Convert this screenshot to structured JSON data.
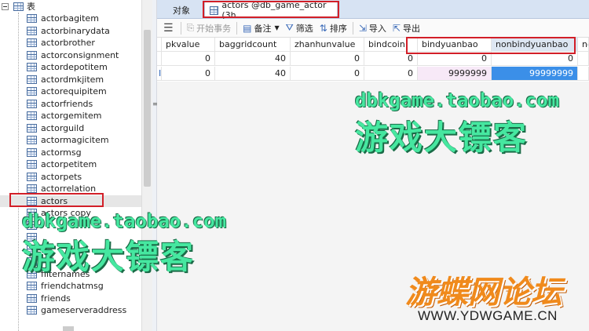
{
  "tree": {
    "root_label": "表",
    "items": [
      {
        "label": "actorbagitem"
      },
      {
        "label": "actorbinarydata"
      },
      {
        "label": "actorbrother"
      },
      {
        "label": "actorconsignment"
      },
      {
        "label": "actordepotitem"
      },
      {
        "label": "actordmkjitem"
      },
      {
        "label": "actorequipitem"
      },
      {
        "label": "actorfriends"
      },
      {
        "label": "actorgemitem"
      },
      {
        "label": "actorguild"
      },
      {
        "label": "actormagicitem"
      },
      {
        "label": "actormsg"
      },
      {
        "label": "actorpetitem"
      },
      {
        "label": "actorpets"
      },
      {
        "label": "actorrelation"
      },
      {
        "label": "actors"
      },
      {
        "label": "actors copy"
      },
      {
        "label": ""
      },
      {
        "label": ""
      },
      {
        "label": ""
      },
      {
        "label": ""
      },
      {
        "label": "filternames"
      },
      {
        "label": "friendchatmsg"
      },
      {
        "label": "friends"
      },
      {
        "label": "gameserveraddress"
      }
    ],
    "selected_index": 15
  },
  "tabs": {
    "objects": "对象",
    "actors": "actors @db_game_actor (3h..."
  },
  "toolbar": {
    "begin_transaction": "开始事务",
    "note": "备注",
    "filter": "筛选",
    "sort": "排序",
    "import": "导入",
    "export": "导出"
  },
  "grid": {
    "columns": [
      "pkvalue",
      "baggridcount",
      "zhanhunvalue",
      "bindcoin",
      "bindyuanbao",
      "nonbindyuanbao",
      "no"
    ],
    "rows": [
      [
        "0",
        "40",
        "0",
        "0",
        "0",
        "0",
        ""
      ],
      [
        "0",
        "40",
        "0",
        "0",
        "9999999",
        "99999999",
        ""
      ]
    ],
    "row_marker": "I"
  },
  "watermarks": {
    "url": "dbkgame.taobao.com",
    "cn": "游戏大镖客",
    "logo_cn": "游蝶网论坛",
    "logo_url": "WWW.YDWGAME.CN"
  },
  "colors": {
    "highlight_box": "#d21f28",
    "selected_cell": "#3b8fe8",
    "watermark_green": "#46e7a0",
    "logo_orange": "#f08a1c"
  }
}
